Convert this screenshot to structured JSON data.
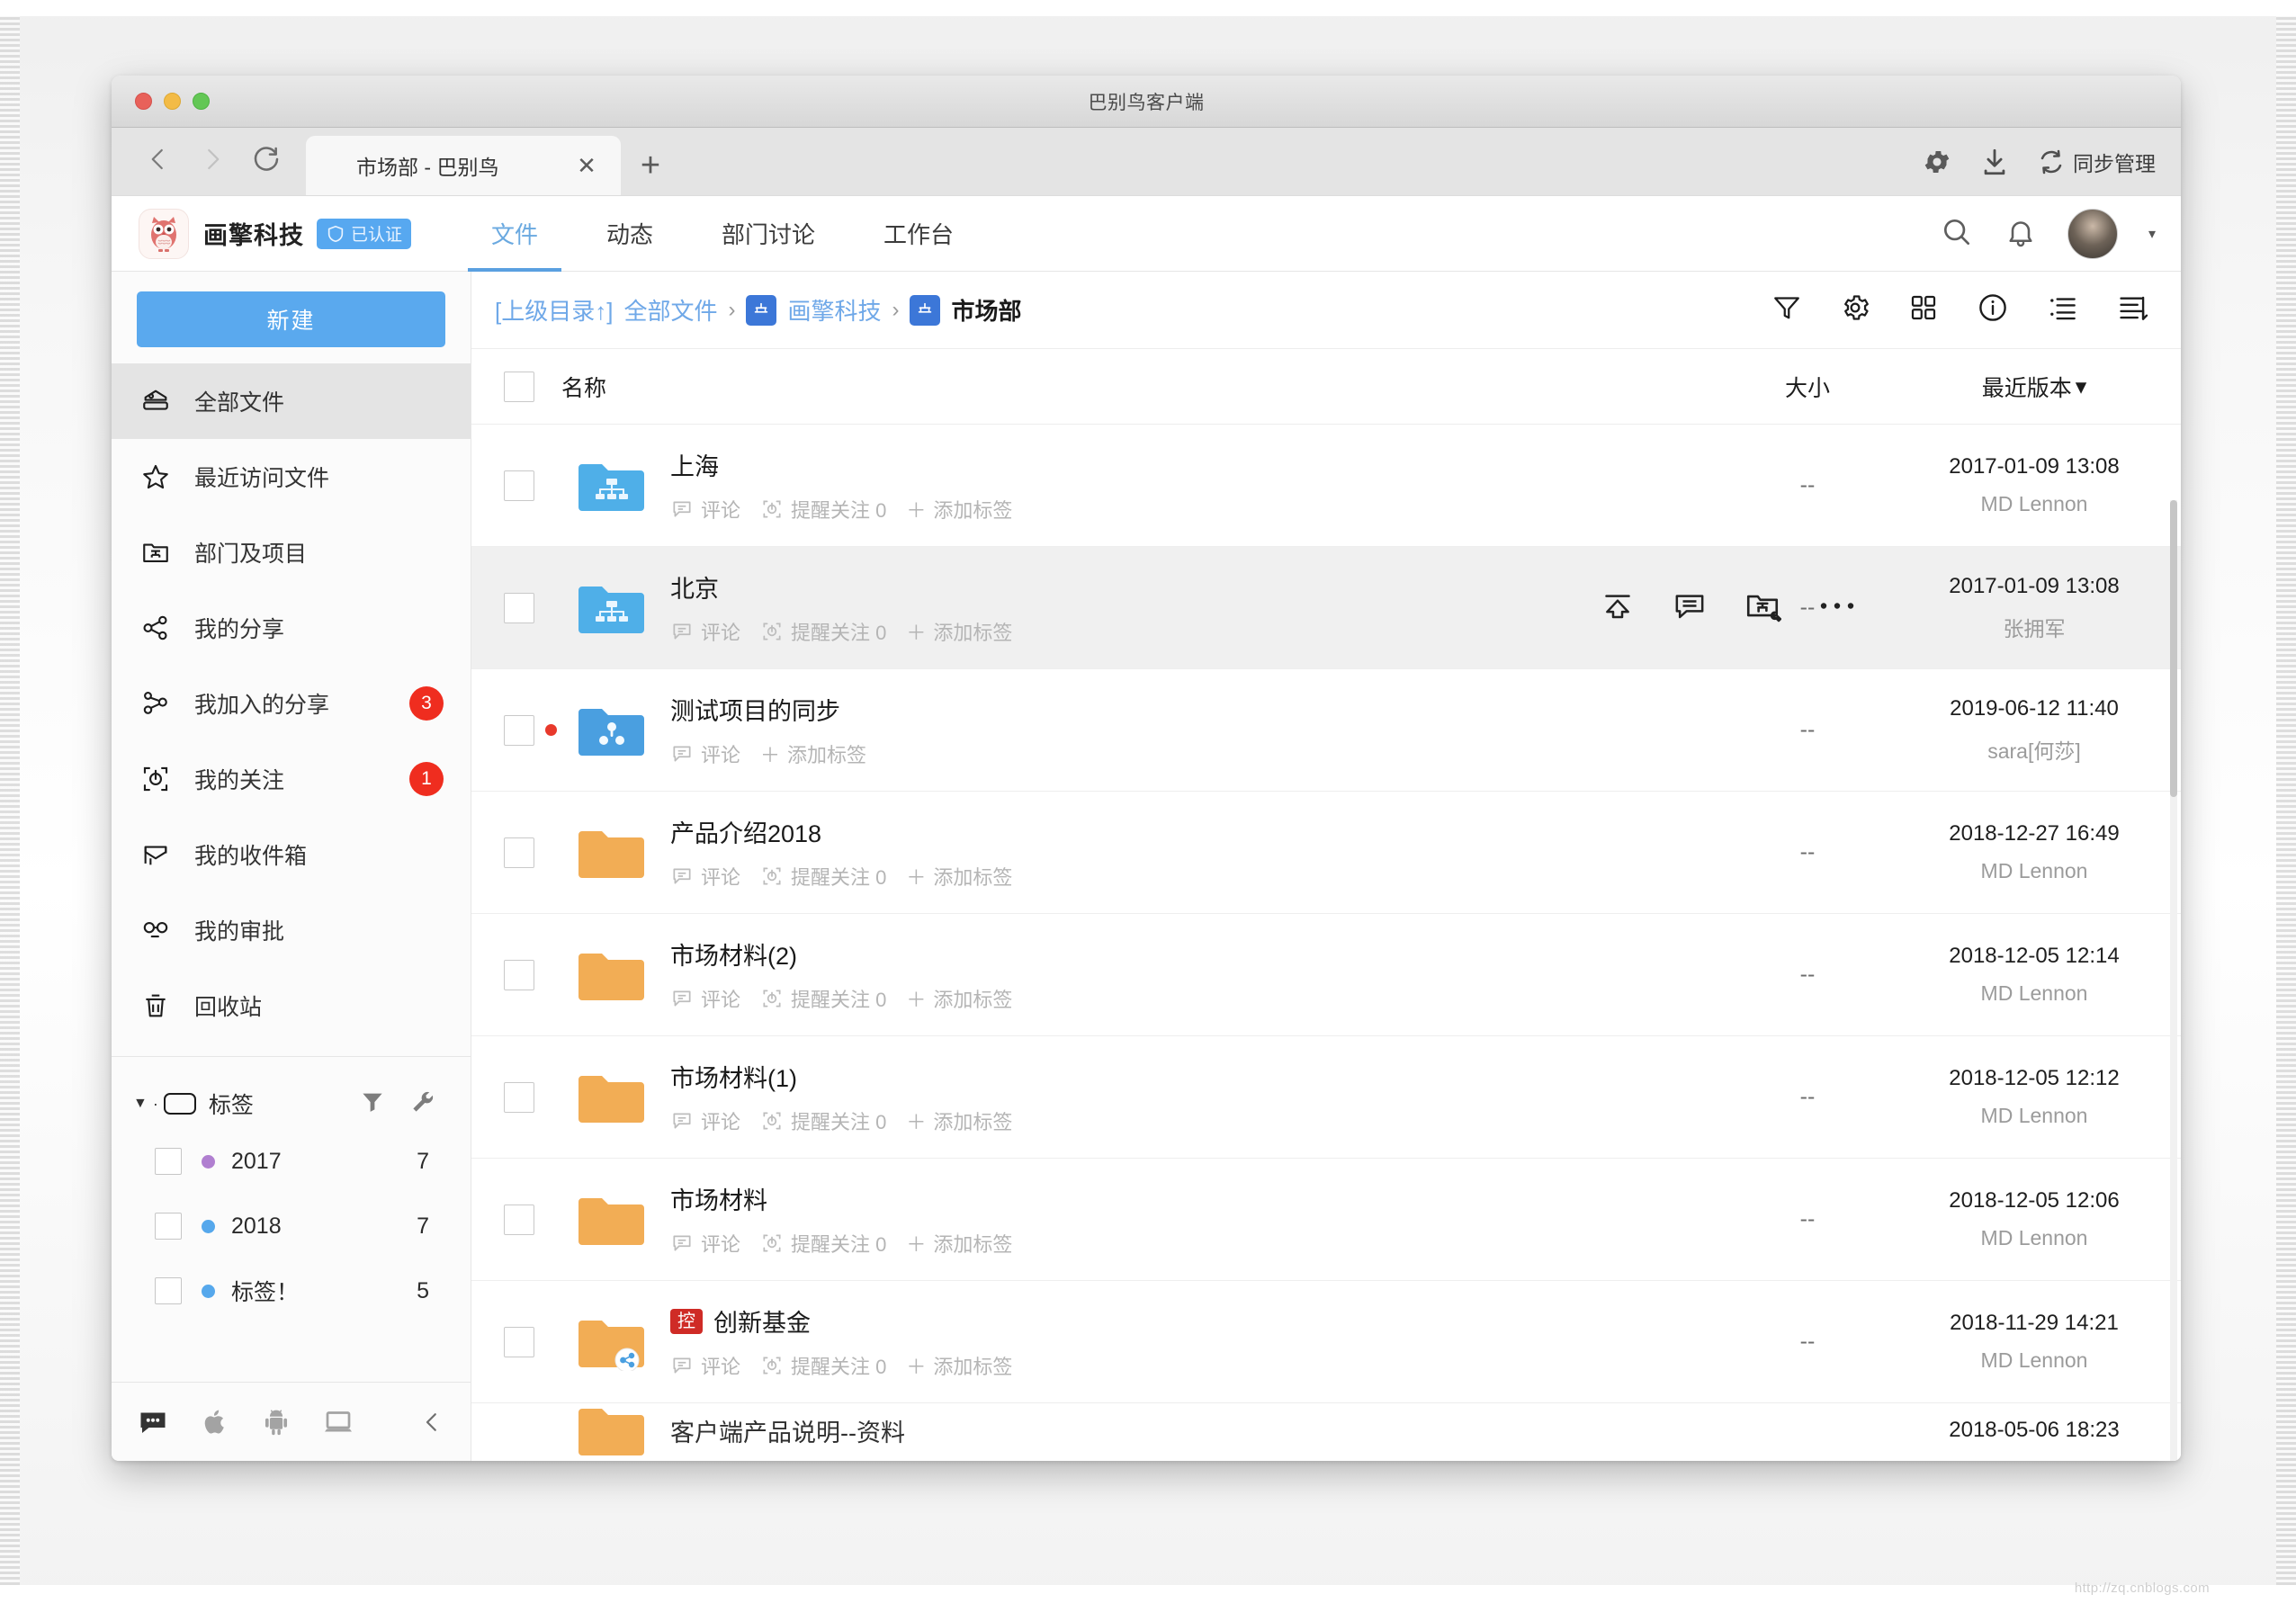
{
  "window": {
    "title": "巴别鸟客户端",
    "traffic_colors": {
      "close": "#e8615a",
      "minimize": "#f3bb46",
      "zoom": "#63c755"
    }
  },
  "browser": {
    "back_icon": "chevron-left-icon",
    "forward_icon": "chevron-right-icon",
    "reload_icon": "reload-icon",
    "tab": {
      "label": "市场部 - 巴别鸟",
      "close_label": "✕"
    },
    "new_tab_label": "+",
    "right": {
      "settings_icon": "gear-icon",
      "download_icon": "download-icon",
      "sync_icon": "sync-icon",
      "sync_label": "同步管理"
    }
  },
  "app_header": {
    "brand_name": "画擎科技",
    "verified_label": "已认证",
    "verified_color": "#57a8f0",
    "nav_tabs": [
      {
        "label": "文件",
        "active": true
      },
      {
        "label": "动态",
        "active": false
      },
      {
        "label": "部门讨论",
        "active": false
      },
      {
        "label": "工作台",
        "active": false
      }
    ],
    "search_icon": "search-icon",
    "bell_icon": "bell-icon",
    "avatar": "user-avatar",
    "caret": "▾"
  },
  "sidebar": {
    "new_button": "新建",
    "items": [
      {
        "label": "全部文件",
        "icon": "all-files-icon",
        "active": true,
        "badge": ""
      },
      {
        "label": "最近访问文件",
        "icon": "star-icon",
        "active": false,
        "badge": ""
      },
      {
        "label": "部门及项目",
        "icon": "department-folder-icon",
        "active": false,
        "badge": ""
      },
      {
        "label": "我的分享",
        "icon": "share-icon",
        "active": false,
        "badge": ""
      },
      {
        "label": "我加入的分享",
        "icon": "joined-share-icon",
        "active": false,
        "badge": "3"
      },
      {
        "label": "我的关注",
        "icon": "focus-target-icon",
        "active": false,
        "badge": "1"
      },
      {
        "label": "我的收件箱",
        "icon": "inbox-icon",
        "active": false,
        "badge": ""
      },
      {
        "label": "我的审批",
        "icon": "approval-icon",
        "active": false,
        "badge": ""
      },
      {
        "label": "回收站",
        "icon": "trash-icon",
        "active": false,
        "badge": ""
      }
    ],
    "tags_section": {
      "title": "标签",
      "filter_icon": "filter-icon",
      "settings_icon": "wrench-icon",
      "tags": [
        {
          "label": "2017",
          "count": "7",
          "color": "#b07fd0"
        },
        {
          "label": "2018",
          "count": "7",
          "color": "#56a8ec"
        },
        {
          "label": "标签！",
          "count": "5",
          "color": "#56a8ec"
        }
      ]
    },
    "footer_icons": [
      "chat-bubble-icon",
      "apple-icon",
      "android-icon",
      "desktop-icon",
      "collapse-icon"
    ]
  },
  "breadcrumb": {
    "parent_link": "[上级目录↑]",
    "root": "全部文件",
    "items": [
      {
        "label": "画擎科技",
        "icon": "org-icon",
        "current": false
      },
      {
        "label": "市场部",
        "icon": "org-icon",
        "current": true
      }
    ],
    "separator": "›",
    "tools": [
      "filter-icon",
      "gear-icon",
      "grid-view-icon",
      "info-icon",
      "list-view-icon",
      "sort-icon"
    ]
  },
  "table": {
    "columns": {
      "name": "名称",
      "size": "大小",
      "version": "最近版本",
      "version_caret": "▾"
    },
    "row_actions": {
      "comment_label": "评论",
      "follow_label": "提醒关注 0",
      "add_tag_label": "添加标签",
      "add_tag_plus": "＋"
    },
    "hover_actions": [
      "upload-icon",
      "comment-icon",
      "folder-settings-icon",
      "more-icon"
    ],
    "rows": [
      {
        "name": "上海",
        "icon": "org-folder-blue",
        "badge": "",
        "shared": false,
        "unread": false,
        "size": "--",
        "date": "2017-01-09 13:08",
        "author": "MD Lennon",
        "actions": [
          "comment",
          "follow",
          "tag"
        ],
        "hover": false
      },
      {
        "name": "北京",
        "icon": "org-folder-blue",
        "badge": "",
        "shared": false,
        "unread": false,
        "size": "--",
        "date": "2017-01-09 13:08",
        "author": "张拥军",
        "actions": [
          "comment",
          "follow",
          "tag"
        ],
        "hover": true
      },
      {
        "name": "测试项目的同步",
        "icon": "project-folder-blue",
        "badge": "",
        "shared": false,
        "unread": true,
        "size": "--",
        "date": "2019-06-12 11:40",
        "author": "sara[何莎]",
        "actions": [
          "comment",
          "tag"
        ],
        "hover": false
      },
      {
        "name": "产品介绍2018",
        "icon": "folder-orange",
        "badge": "",
        "shared": false,
        "unread": false,
        "size": "--",
        "date": "2018-12-27 16:49",
        "author": "MD Lennon",
        "actions": [
          "comment",
          "follow",
          "tag"
        ],
        "hover": false
      },
      {
        "name": "市场材料(2)",
        "icon": "folder-orange",
        "badge": "",
        "shared": false,
        "unread": false,
        "size": "--",
        "date": "2018-12-05 12:14",
        "author": "MD Lennon",
        "actions": [
          "comment",
          "follow",
          "tag"
        ],
        "hover": false
      },
      {
        "name": "市场材料(1)",
        "icon": "folder-orange",
        "badge": "",
        "shared": false,
        "unread": false,
        "size": "--",
        "date": "2018-12-05 12:12",
        "author": "MD Lennon",
        "actions": [
          "comment",
          "follow",
          "tag"
        ],
        "hover": false
      },
      {
        "name": "市场材料",
        "icon": "folder-orange",
        "badge": "",
        "shared": false,
        "unread": false,
        "size": "--",
        "date": "2018-12-05 12:06",
        "author": "MD Lennon",
        "actions": [
          "comment",
          "follow",
          "tag"
        ],
        "hover": false
      },
      {
        "name": "创新基金",
        "icon": "folder-orange",
        "badge": "控",
        "shared": true,
        "unread": false,
        "size": "--",
        "date": "2018-11-29 14:21",
        "author": "MD Lennon",
        "actions": [
          "comment",
          "follow",
          "tag"
        ],
        "hover": false
      },
      {
        "name": "客户端产品说明--资料",
        "icon": "folder-orange",
        "badge": "",
        "shared": false,
        "unread": false,
        "size": "",
        "date": "2018-05-06 18:23",
        "author": "",
        "actions": [],
        "hover": false,
        "clipped": true
      }
    ]
  },
  "watermark": "http://zq.cnblogs.com"
}
